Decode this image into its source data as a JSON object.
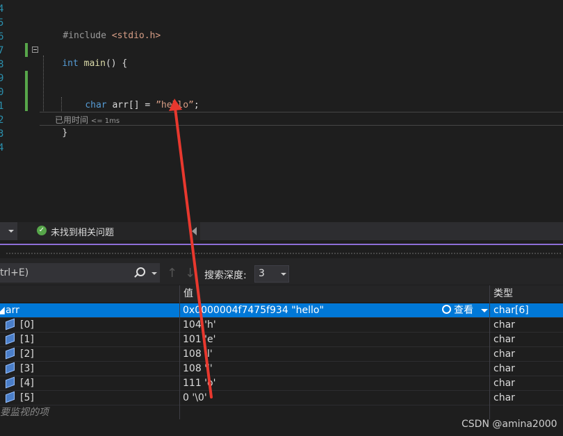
{
  "editor": {
    "line_numbers": [
      "4",
      "5",
      "6",
      "7",
      "8",
      "9",
      "0",
      "1",
      "2",
      "3",
      "4"
    ],
    "include_directive": "#include",
    "include_header": "<stdio.h>",
    "main_keyword": "int",
    "main_name": "main",
    "main_rest": "() {",
    "char_keyword": "char",
    "decl_mid": " arr[] = ",
    "string_literal": "”hello”",
    "semicolon": ";",
    "close_brace": "}",
    "elapsed_label": "已用时间",
    "elapsed_value": "<= 1ms"
  },
  "status": {
    "issues_text": "未找到相关问题"
  },
  "watch": {
    "search_placeholder": "trl+E)",
    "depth_label": "搜索深度:",
    "depth_value": "3",
    "headers": {
      "value": "值",
      "type": "类型"
    },
    "root": {
      "name": "arr",
      "value": "0x0000004f7475f934 \"hello\"",
      "view_label": "查看",
      "type": "char[6]"
    },
    "rows": [
      {
        "name": "[0]",
        "value": "104 'h'",
        "type": "char"
      },
      {
        "name": "[1]",
        "value": "101 'e'",
        "type": "char"
      },
      {
        "name": "[2]",
        "value": "108 'l'",
        "type": "char"
      },
      {
        "name": "[3]",
        "value": "108 'l'",
        "type": "char"
      },
      {
        "name": "[4]",
        "value": "111 'o'",
        "type": "char"
      },
      {
        "name": "[5]",
        "value": "0 '\\0'",
        "type": "char"
      }
    ],
    "add_watch_text": "要监视的项"
  },
  "watermark": "CSDN @amina2000",
  "colors": {
    "accent": "#0078d7",
    "purple_rule": "#8e6fd8",
    "arrow": "#e8382e",
    "change_bar": "#57a64a"
  }
}
